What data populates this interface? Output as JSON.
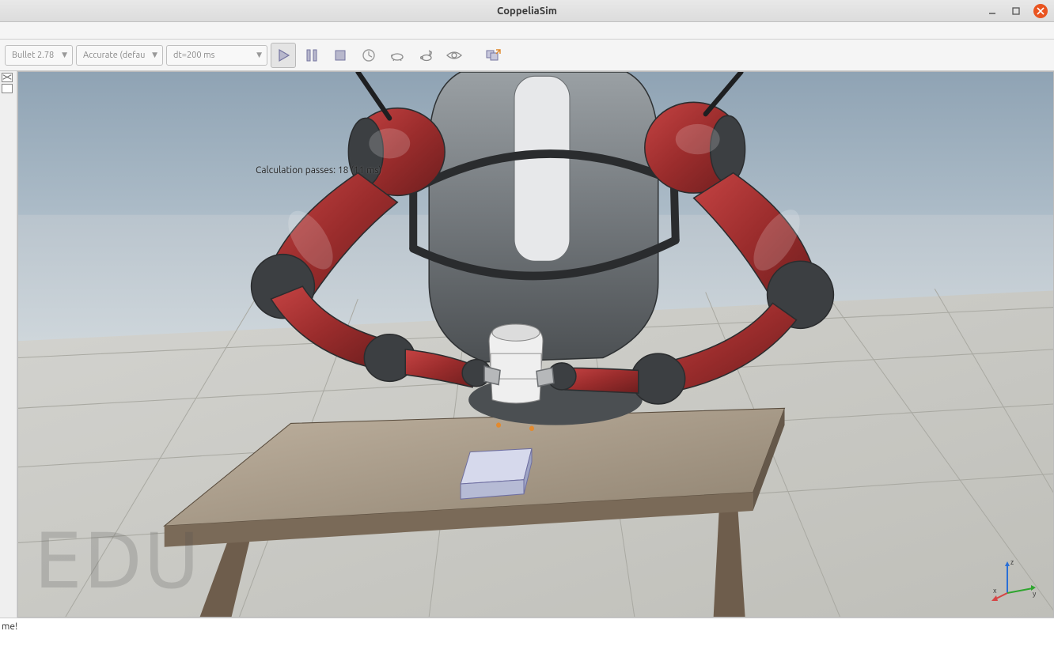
{
  "window": {
    "title": "CoppeliaSim"
  },
  "toolbar": {
    "physics_engine": "Bullet 2.78",
    "dynamics_mode": "Accurate (defau",
    "timestep": "dt=200 ms"
  },
  "viewport": {
    "overlay_text": "Calculation passes: 18 (11 ms)",
    "watermark": "EDU",
    "axes": {
      "x": "x",
      "y": "y",
      "z": "z"
    }
  },
  "status": {
    "message": "me!"
  }
}
